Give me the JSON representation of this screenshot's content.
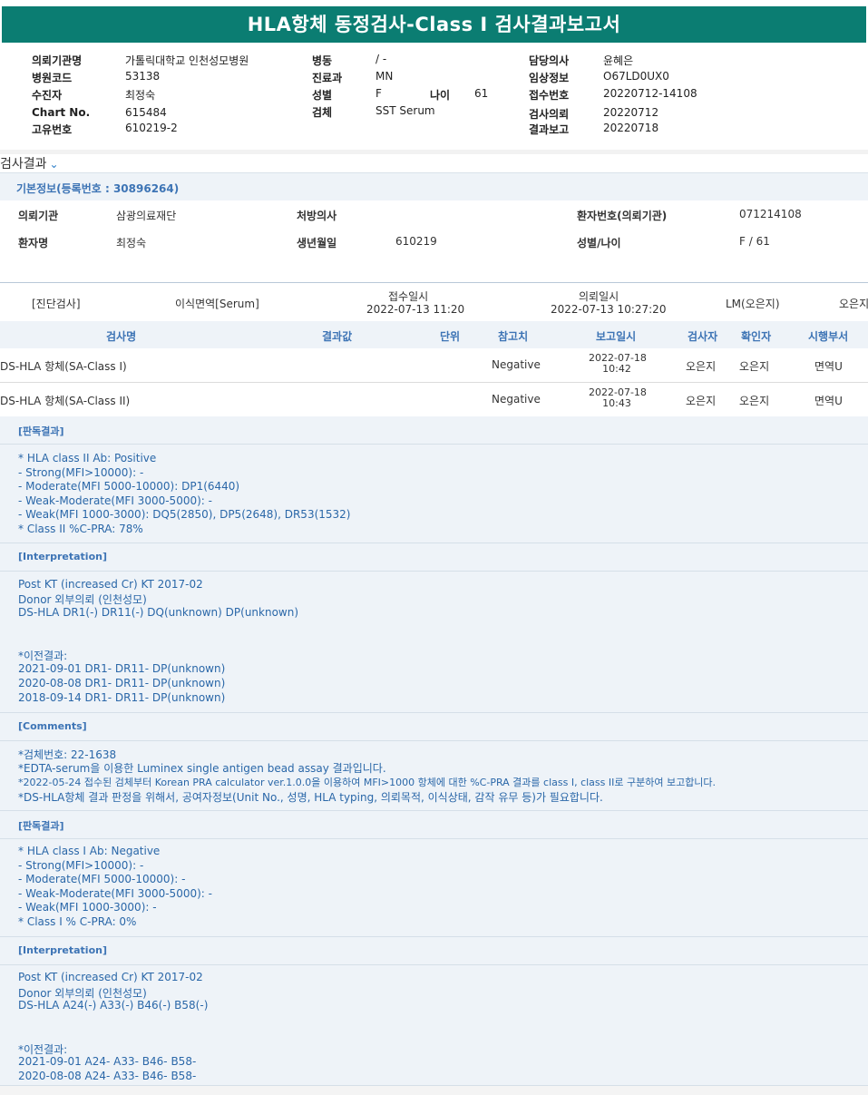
{
  "report": {
    "title": "HLA항체 동정검사-Class I 검사결과보고서"
  },
  "header": {
    "col1": [
      {
        "label": "의뢰기관명",
        "value": "가톨릭대학교 인천성모병원"
      },
      {
        "label": "병원코드",
        "value": "53138"
      },
      {
        "label": "수진자",
        "value": "최정숙"
      },
      {
        "label": "Chart No.",
        "value": "615484"
      },
      {
        "label": "고유번호",
        "value": "610219-2"
      }
    ],
    "col2": [
      {
        "label": "병동",
        "value": "/ -"
      },
      {
        "label": "진료과",
        "value": "MN"
      },
      {
        "label": "성별",
        "value": "F"
      },
      {
        "label": "검체",
        "value": "SST Serum"
      }
    ],
    "age": {
      "label": "나이",
      "value": "61"
    },
    "col3": [
      {
        "label": "담당의사",
        "value": "윤혜은"
      },
      {
        "label": "임상정보",
        "value": "O67LD0UX0"
      },
      {
        "label": "접수번호",
        "value": "20220712-14108"
      },
      {
        "label": "검사의뢰",
        "value": "20220712"
      },
      {
        "label": "결과보고",
        "value": "20220718"
      }
    ]
  },
  "results_tab": {
    "title": "검사결과"
  },
  "basic_info": {
    "header": "기본정보(등록번호 : 30896264)",
    "row1": {
      "org_label": "의뢰기관",
      "org_value": "삼광의료재단",
      "doctor_label": "처방의사",
      "doctor_value": "",
      "pid_label": "환자번호(의뢰기관)",
      "pid_value": "071214108"
    },
    "row2": {
      "name_label": "환자명",
      "name_value": "최정숙",
      "birth_label": "생년월일",
      "birth_value": "610219",
      "sex_label": "성별/나이",
      "sex_value": "F / 61"
    }
  },
  "order": {
    "dept": "[진단검사]",
    "specimen": "이식면역[Serum]",
    "received_label": "접수일시",
    "received_value": "2022-07-13 11:20",
    "requested_label": "의뢰일시",
    "requested_value": "2022-07-13 10:27:20",
    "lm": "LM(오은지)",
    "staff": "오은지"
  },
  "table": {
    "headers": [
      "검사명",
      "결과값",
      "단위",
      "참고치",
      "보고일시",
      "검사자",
      "확인자",
      "시행부서"
    ],
    "rows": [
      {
        "name": "DS-HLA 항체(SA-Class I)",
        "result": "",
        "unit": "",
        "ref": "Negative",
        "date": "2022-07-18",
        "time": "10:42",
        "tester": "오은지",
        "checker": "오은지",
        "dept": "면역U"
      },
      {
        "name": "DS-HLA 항체(SA-Class II)",
        "result": "",
        "unit": "",
        "ref": "Negative",
        "date": "2022-07-18",
        "time": "10:43",
        "tester": "오은지",
        "checker": "오은지",
        "dept": "면역U"
      }
    ]
  },
  "sections": {
    "s1": {
      "title": "[판독결과]",
      "lines": [
        "* HLA class II Ab: Positive",
        "- Strong(MFI>10000): -",
        "- Moderate(MFI 5000-10000): DP1(6440)",
        "- Weak-Moderate(MFI 3000-5000): -",
        "- Weak(MFI 1000-3000): DQ5(2850), DP5(2648), DR53(1532)",
        "* Class II %C-PRA: 78%"
      ]
    },
    "s2": {
      "title": "[Interpretation]",
      "lines": [
        "Post KT (increased Cr) KT 2017-02",
        "Donor 외부의뢰 (인천성모)",
        "DS-HLA DR1(-) DR11(-) DQ(unknown) DP(unknown)"
      ],
      "prev_title": "*이전결과:",
      "prev": [
        "2021-09-01 DR1- DR11- DP(unknown)",
        "2020-08-08 DR1- DR11- DP(unknown)",
        "2018-09-14 DR1- DR11- DP(unknown)"
      ]
    },
    "s3": {
      "title": "[Comments]",
      "lines": [
        "*검체번호: 22-1638",
        "*EDTA-serum을 이용한 Luminex single antigen bead assay 결과입니다.",
        "*2022-05-24 접수된 검체부터 Korean PRA calculator ver.1.0.0을 이용하여 MFI>1000 항체에 대한 %C-PRA 결과를 class I, class II로 구분하여 보고합니다.",
        "*DS-HLA항체 결과 판정을 위해서, 공여자정보(Unit No., 성명, HLA typing, 의뢰목적, 이식상태, 감작 유무 등)가 필요합니다."
      ]
    },
    "s4": {
      "title": "[판독결과]",
      "lines": [
        "* HLA class I Ab: Negative",
        "- Strong(MFI>10000): -",
        "- Moderate(MFI 5000-10000): -",
        "- Weak-Moderate(MFI 3000-5000): -",
        "- Weak(MFI 1000-3000): -",
        "* Class I % C-PRA: 0%"
      ]
    },
    "s5": {
      "title": "[Interpretation]",
      "lines": [
        "Post KT (increased Cr) KT 2017-02",
        "Donor 외부의뢰 (인천성모)",
        "DS-HLA A24(-) A33(-) B46(-) B58(-)"
      ],
      "prev_title": "*이전결과:",
      "prev": [
        "2021-09-01 A24- A33- B46- B58-",
        "2020-08-08 A24- A33- B46- B58-"
      ]
    }
  }
}
